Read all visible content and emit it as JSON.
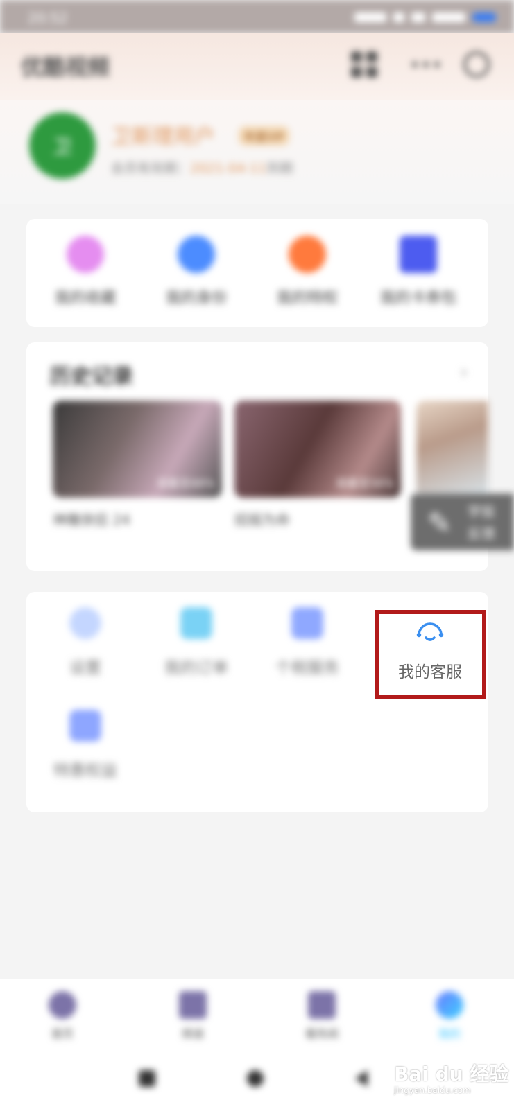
{
  "status_bar": {
    "time": "20:52"
  },
  "header": {
    "title": "优酷视频",
    "grid_icon": "grid-icon",
    "more_icon": "more-icon",
    "settings_icon": "settings-icon"
  },
  "profile": {
    "avatar_initial": "卫",
    "username": "卫斯理用户",
    "vip_badge": "年度VIP",
    "member_prefix": "会员有效期：",
    "member_date": "2021-04-11",
    "member_suffix": "到期"
  },
  "quick_actions": [
    {
      "label": "我的收藏",
      "icon": "star-icon",
      "color": "#e58df0"
    },
    {
      "label": "我的身份",
      "icon": "id-icon",
      "color": "#4c8cff"
    },
    {
      "label": "我的特权",
      "icon": "gift-icon",
      "color": "#ff7a3d"
    },
    {
      "label": "我的卡券包",
      "icon": "ticket-icon",
      "color": "#4d5cf0"
    }
  ],
  "history": {
    "title": "历史记录",
    "more": "›",
    "items": [
      {
        "label": "神雕侠侣 24",
        "tag": "观看至88%"
      },
      {
        "label": "招摇为命",
        "tag": "观看至56%"
      }
    ]
  },
  "float_button": {
    "line1": "学投",
    "line2": "反馈"
  },
  "services": [
    {
      "label": "设置",
      "icon": "settings-icon",
      "color": "#c4d6ff"
    },
    {
      "label": "我的订单",
      "icon": "order-icon",
      "color": "#7ad2f5"
    },
    {
      "label": "个税服务",
      "icon": "tax-icon",
      "color": "#8fa8ff"
    },
    {
      "label": "特惠权益",
      "icon": "gift-box-icon",
      "color": "#8ea6ff"
    }
  ],
  "customer_service": {
    "label": "我的客服",
    "icon": "headset-icon",
    "color": "#3a8ff0"
  },
  "bottom_nav": [
    {
      "label": "首页",
      "icon": "home-icon"
    },
    {
      "label": "频道",
      "icon": "channel-icon"
    },
    {
      "label": "看热闹",
      "icon": "hot-icon"
    },
    {
      "label": "我的",
      "icon": "mine-icon",
      "active": true
    }
  ],
  "watermark": {
    "brand": "Bai du 经验",
    "url": "jingyan.baidu.com"
  }
}
